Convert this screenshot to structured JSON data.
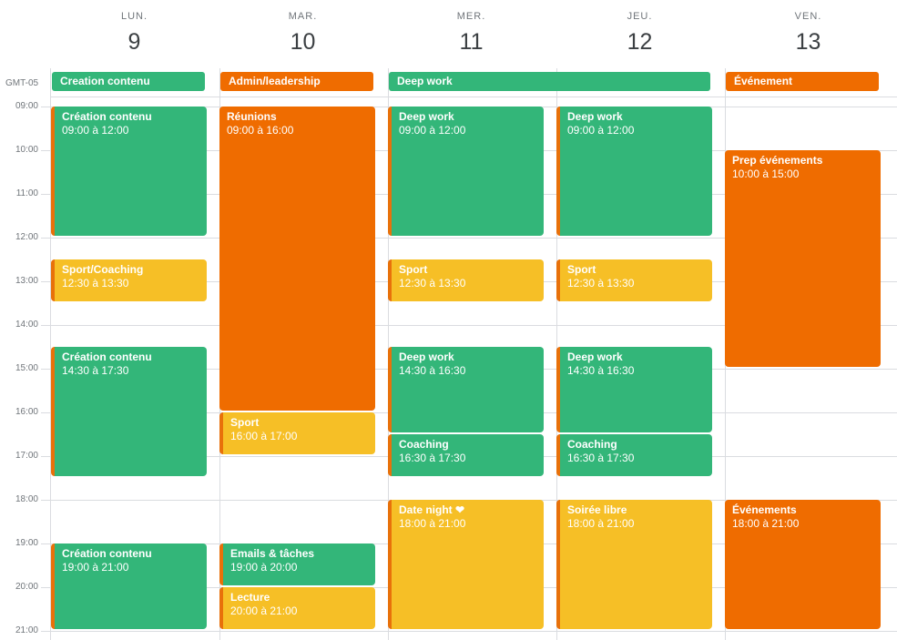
{
  "timezone": "GMT-05",
  "days": [
    {
      "dow": "LUN.",
      "num": "9"
    },
    {
      "dow": "MAR.",
      "num": "10"
    },
    {
      "dow": "MER.",
      "num": "11"
    },
    {
      "dow": "JEU.",
      "num": "12"
    },
    {
      "dow": "VEN.",
      "num": "13"
    }
  ],
  "hours": [
    "09:00",
    "10:00",
    "11:00",
    "12:00",
    "13:00",
    "14:00",
    "15:00",
    "16:00",
    "17:00",
    "18:00",
    "19:00",
    "20:00",
    "21:00"
  ],
  "colors": {
    "green": "#33b679",
    "orange": "#ef6c00",
    "yellow": "#f6bf26",
    "stripe": "#e8710a"
  },
  "allday": [
    {
      "title": "Creation contenu",
      "color": "green",
      "day_start": 0,
      "day_end": 0
    },
    {
      "title": "Admin/leadership",
      "color": "orange",
      "day_start": 1,
      "day_end": 1
    },
    {
      "title": "Deep work",
      "color": "green",
      "day_start": 2,
      "day_end": 3
    },
    {
      "title": "Événement",
      "color": "orange",
      "day_start": 4,
      "day_end": 4
    }
  ],
  "events": [
    {
      "day": 0,
      "title": "Création contenu",
      "time": "09:00 à 12:00",
      "start": 9.0,
      "end": 12.0,
      "color": "green",
      "stripe": true
    },
    {
      "day": 0,
      "title": "Sport/Coaching",
      "time": "12:30 à 13:30",
      "start": 12.5,
      "end": 13.5,
      "color": "yellow",
      "stripe": true
    },
    {
      "day": 0,
      "title": "Création contenu",
      "time": "14:30 à 17:30",
      "start": 14.5,
      "end": 17.5,
      "color": "green",
      "stripe": true
    },
    {
      "day": 0,
      "title": "Création contenu",
      "time": "19:00 à 21:00",
      "start": 19.0,
      "end": 21.0,
      "color": "green",
      "stripe": true
    },
    {
      "day": 1,
      "title": "Réunions",
      "time": "09:00 à 16:00",
      "start": 9.0,
      "end": 16.0,
      "color": "orange",
      "stripe": false
    },
    {
      "day": 1,
      "title": "Sport",
      "time": "16:00 à 17:00",
      "start": 16.0,
      "end": 17.0,
      "color": "yellow",
      "stripe": true
    },
    {
      "day": 1,
      "title": "Emails & tâches",
      "time": "19:00 à 20:00",
      "start": 19.0,
      "end": 20.0,
      "color": "green",
      "stripe": true
    },
    {
      "day": 1,
      "title": "Lecture",
      "time": "20:00 à 21:00",
      "start": 20.0,
      "end": 21.0,
      "color": "yellow",
      "stripe": true
    },
    {
      "day": 2,
      "title": "Deep work",
      "time": "09:00 à 12:00",
      "start": 9.0,
      "end": 12.0,
      "color": "green",
      "stripe": true
    },
    {
      "day": 2,
      "title": "Sport",
      "time": "12:30 à 13:30",
      "start": 12.5,
      "end": 13.5,
      "color": "yellow",
      "stripe": true
    },
    {
      "day": 2,
      "title": "Deep work",
      "time": "14:30 à 16:30",
      "start": 14.5,
      "end": 16.5,
      "color": "green",
      "stripe": true
    },
    {
      "day": 2,
      "title": "Coaching",
      "time": "16:30 à 17:30",
      "start": 16.5,
      "end": 17.5,
      "color": "green",
      "stripe": true
    },
    {
      "day": 2,
      "title": "Date night ❤",
      "time": "18:00 à 21:00",
      "start": 18.0,
      "end": 21.0,
      "color": "yellow",
      "stripe": true
    },
    {
      "day": 3,
      "title": "Deep work",
      "time": "09:00 à 12:00",
      "start": 9.0,
      "end": 12.0,
      "color": "green",
      "stripe": true
    },
    {
      "day": 3,
      "title": "Sport",
      "time": "12:30 à 13:30",
      "start": 12.5,
      "end": 13.5,
      "color": "yellow",
      "stripe": true
    },
    {
      "day": 3,
      "title": "Deep work",
      "time": "14:30 à 16:30",
      "start": 14.5,
      "end": 16.5,
      "color": "green",
      "stripe": true
    },
    {
      "day": 3,
      "title": "Coaching",
      "time": "16:30 à 17:30",
      "start": 16.5,
      "end": 17.5,
      "color": "green",
      "stripe": true
    },
    {
      "day": 3,
      "title": "Soirée libre",
      "time": "18:00 à 21:00",
      "start": 18.0,
      "end": 21.0,
      "color": "yellow",
      "stripe": true
    },
    {
      "day": 4,
      "title": "Prep événements",
      "time": "10:00 à 15:00",
      "start": 10.0,
      "end": 15.0,
      "color": "orange",
      "stripe": false
    },
    {
      "day": 4,
      "title": "Événements",
      "time": "18:00 à 21:00",
      "start": 18.0,
      "end": 21.0,
      "color": "orange",
      "stripe": false
    }
  ]
}
